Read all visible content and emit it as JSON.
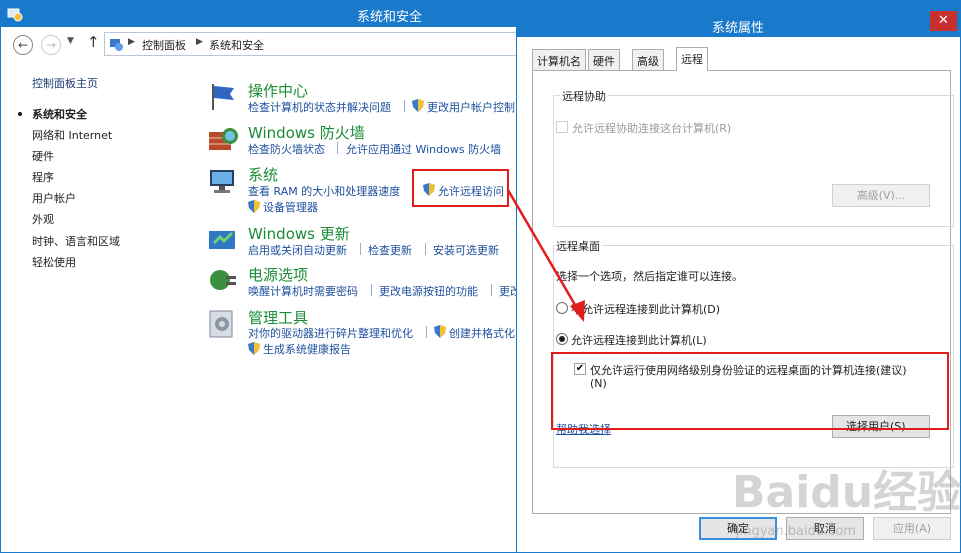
{
  "control_panel": {
    "title": "系统和安全",
    "breadcrumb": [
      "控制面板",
      "系统和安全"
    ],
    "sidebar": {
      "home": "控制面板主页",
      "items": [
        "系统和安全",
        "网络和 Internet",
        "硬件",
        "程序",
        "用户帐户",
        "外观",
        "时钟、语言和区域",
        "轻松使用"
      ]
    },
    "categories": {
      "action_center": {
        "title": "操作中心",
        "link1": "检查计算机的状态并解决问题",
        "link2": "更改用户帐户控制"
      },
      "firewall": {
        "title": "Windows 防火墙",
        "link1": "检查防火墙状态",
        "link2": "允许应用通过 Windows 防火墙"
      },
      "system": {
        "title": "系统",
        "link1": "查看 RAM 的大小和处理器速度",
        "link2": "允许远程访问",
        "link3": "设备管理器"
      },
      "update": {
        "title": "Windows 更新",
        "link1": "启用或关闭自动更新",
        "link2": "检查更新",
        "link3": "安装可选更新"
      },
      "power": {
        "title": "电源选项",
        "link1": "唤醒计算机时需要密码",
        "link2": "更改电源按钮的功能",
        "link3": "更改"
      },
      "admin_tools": {
        "title": "管理工具",
        "link1": "对你的驱动器进行碎片整理和优化",
        "link2": "创建并格式化",
        "link3": "生成系统健康报告"
      }
    }
  },
  "dialog": {
    "title": "系统属性",
    "close": "✕",
    "tabs": [
      "计算机名",
      "硬件",
      "高级",
      "远程"
    ],
    "active_tab": "远程",
    "remote_assistance": {
      "group_label": "远程协助",
      "checkbox_label": "允许远程协助连接这台计算机(R)",
      "checked": false,
      "advanced_button": "高级(V)..."
    },
    "remote_desktop": {
      "group_label": "远程桌面",
      "instruction": "选择一个选项，然后指定谁可以连接。",
      "option_deny": "不允许远程连接到此计算机(D)",
      "option_allow": "允许远程连接到此计算机(L)",
      "selected": "option_allow",
      "nla_label_line1": "仅允许运行使用网络级别身份验证的远程桌面的计算机连接(建议)",
      "nla_label_line2": "(N)",
      "nla_checked": true,
      "help_link": "帮助我选择",
      "select_users_button": "选择用户(S)..."
    },
    "buttons": {
      "ok": "确定",
      "cancel": "取消",
      "apply": "应用(A)"
    }
  },
  "watermark": {
    "logo": "Baidu经验",
    "url": "jingyan.baidu.com"
  },
  "colors": {
    "titlebar": "#1979ca",
    "category_title": "#1a8c35",
    "link": "#1d4f9e",
    "highlight": "#e31c1c",
    "close": "#c7302d"
  }
}
